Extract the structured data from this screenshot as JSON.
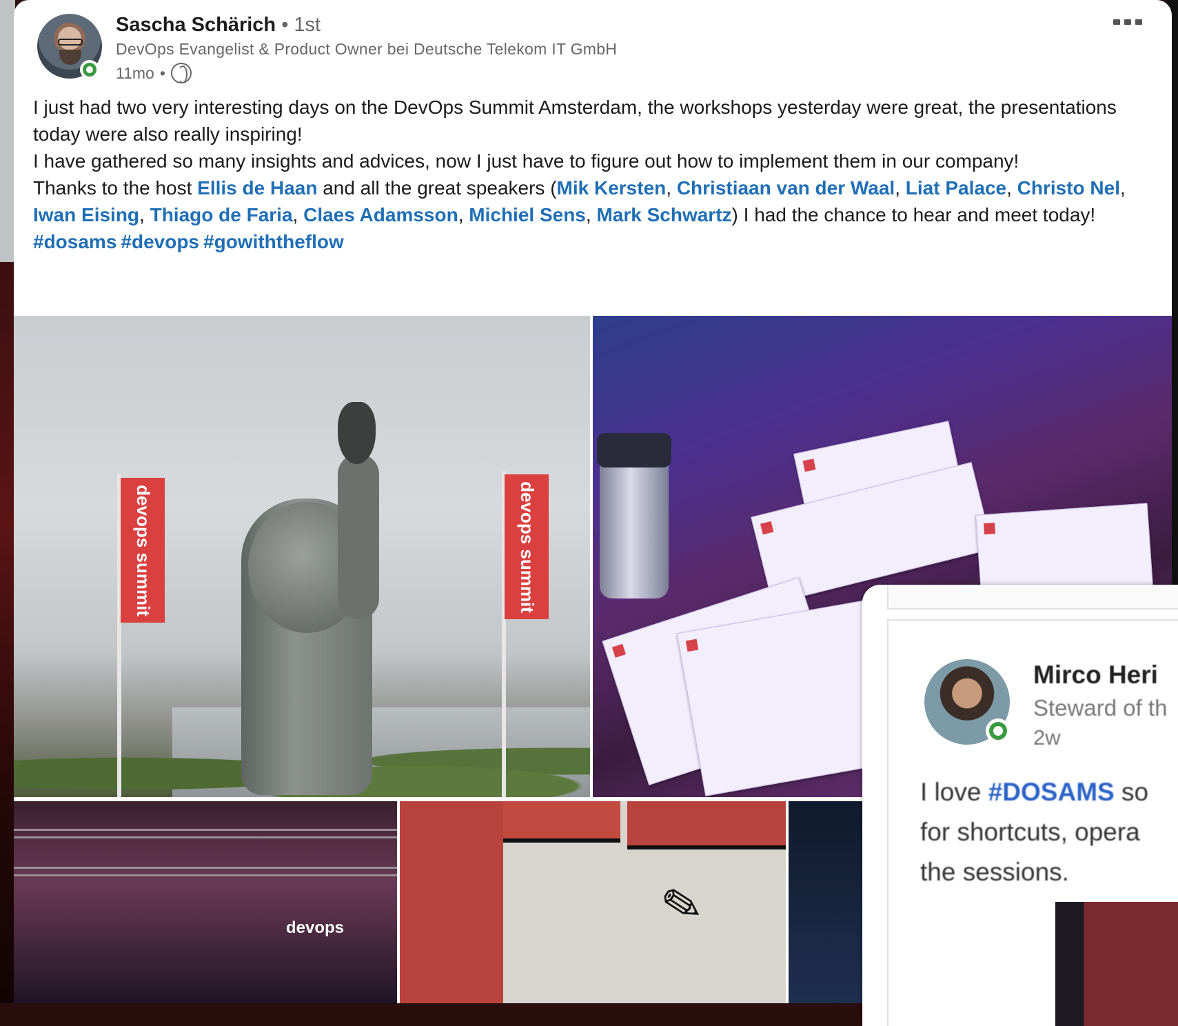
{
  "author": {
    "name": "Sascha Schärich",
    "separator": "•",
    "degree": "1st",
    "headline": "DevOps Evangelist & Product Owner bei Deutsche Telekom IT GmbH",
    "time": "11mo",
    "visibility_separator": "•",
    "visibility_icon": "globe-icon"
  },
  "post": {
    "line1": "I just had two very interesting days on the DevOps Summit Amsterdam, the workshops yesterday were great, the presentations today were also really inspiring!",
    "line2": "I have gathered so many insights and advices, now I just have to figure out how to implement them in our company!",
    "thanks_prefix": "Thanks to the host ",
    "host": "Ellis de Haan",
    "speakers_intro": " and all the great speakers (",
    "speakers": [
      "Mik Kersten",
      "Christiaan van der Waal",
      "Liat Palace",
      "Christo Nel",
      "Iwan Eising",
      "Thiago de Faria",
      "Claes Adamsson",
      "Michiel Sens",
      "Mark Schwartz"
    ],
    "comma": ", ",
    "thanks_suffix": ") I had the chance to hear and meet today!",
    "hashtags": [
      "#dosams",
      "#devops",
      "#gowiththeflow"
    ]
  },
  "images": {
    "flag_text_left": "devops summit",
    "flag_text_right": "devops summit",
    "stage_logo": "devops"
  },
  "overlay": {
    "name": "Mirco Heri",
    "headline": "Steward of th",
    "time": "2w",
    "text_prefix": "I love ",
    "text_tag": "#DOSAMS",
    "text_after_tag": " so",
    "text_line2": "for shortcuts, opera",
    "text_line3": "the sessions."
  },
  "colors": {
    "link": "#1f6fb5",
    "online": "#3a9a3e",
    "text": "#1b1b1b",
    "muted": "#666666"
  }
}
